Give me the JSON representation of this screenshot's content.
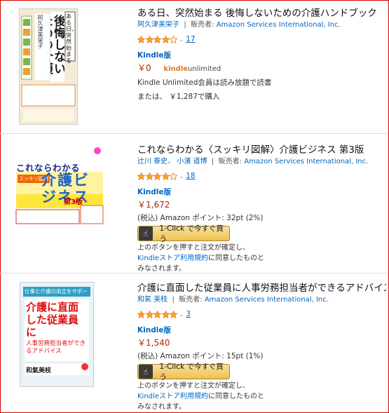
{
  "books": [
    {
      "title": "ある日、突然始まる 後悔しないための介護ハンドブック",
      "authors": [
        "阿久津美栄子"
      ],
      "seller_label": "販売者:",
      "seller": "Amazon Services International, Inc.",
      "rating": 4,
      "review_count": "17",
      "format": "Kindle版",
      "price": "￥0",
      "ku_logo_a": "kindle",
      "ku_logo_b": "unlimited",
      "ku_note": "Kindle Unlimited会員は読み放題で読書",
      "alt_price": "または、 ￥1,287で購入",
      "cover": {
        "line1": "ある日、突然始まる",
        "title": "後悔しないための介護ハンドブック",
        "author": "阿久津美栄子",
        "bg": "#f3ead7"
      }
    },
    {
      "title": "これならわかる〈スッキリ図解〉介護ビジネス 第3版",
      "authors": [
        "辻川 泰史",
        "小濱 道博"
      ],
      "seller_label": "販売者:",
      "seller": "Amazon Services International, Inc.",
      "rating": 4,
      "review_count": "18",
      "format": "Kindle版",
      "price": "￥1,672",
      "points": "(税込) Amazon ポイント: 32pt (2%)",
      "buy_label": "1-Click で今すぐ買う",
      "note_a": "上のボタンを押すと注文が確定し、",
      "note_link": "Kindleストア利用規約",
      "note_b": "に同意したものと",
      "note_c": "みなされます。",
      "cover": {
        "line1": "これならわかる",
        "sub": "スッキリ図解",
        "title": "介護ビジネス",
        "edition": "第3版",
        "bg": "#ffffff"
      }
    },
    {
      "title": "介護に直面した従業員に人事労務担当者ができるアドバイス",
      "authors": [
        "和氣 美枝"
      ],
      "seller_label": "販売者:",
      "seller": "Amazon Services International, Inc.",
      "rating": 5,
      "review_count": "3",
      "format": "Kindle版",
      "price": "￥1,540",
      "points": "(税込) Amazon ポイント: 15pt (1%)",
      "buy_label": "1-Click で今すぐ買う",
      "note_a": "上のボタンを押すと注文が確定し、",
      "note_link": "Kindleストア利用規約",
      "note_b": "に同意したものと",
      "note_c": "みなされます。",
      "cover": {
        "top": "仕事と介護の両立をサポート!",
        "title": "介護に直面した従業員に",
        "sub": "人事労務担当者ができるアドバイス",
        "author": "和氣美枝",
        "bg": "#e9f3f8"
      }
    }
  ],
  "colors": {
    "link": "#0066c0",
    "price": "#b12704",
    "star": "#ffa41c",
    "frame": "#d40000"
  }
}
